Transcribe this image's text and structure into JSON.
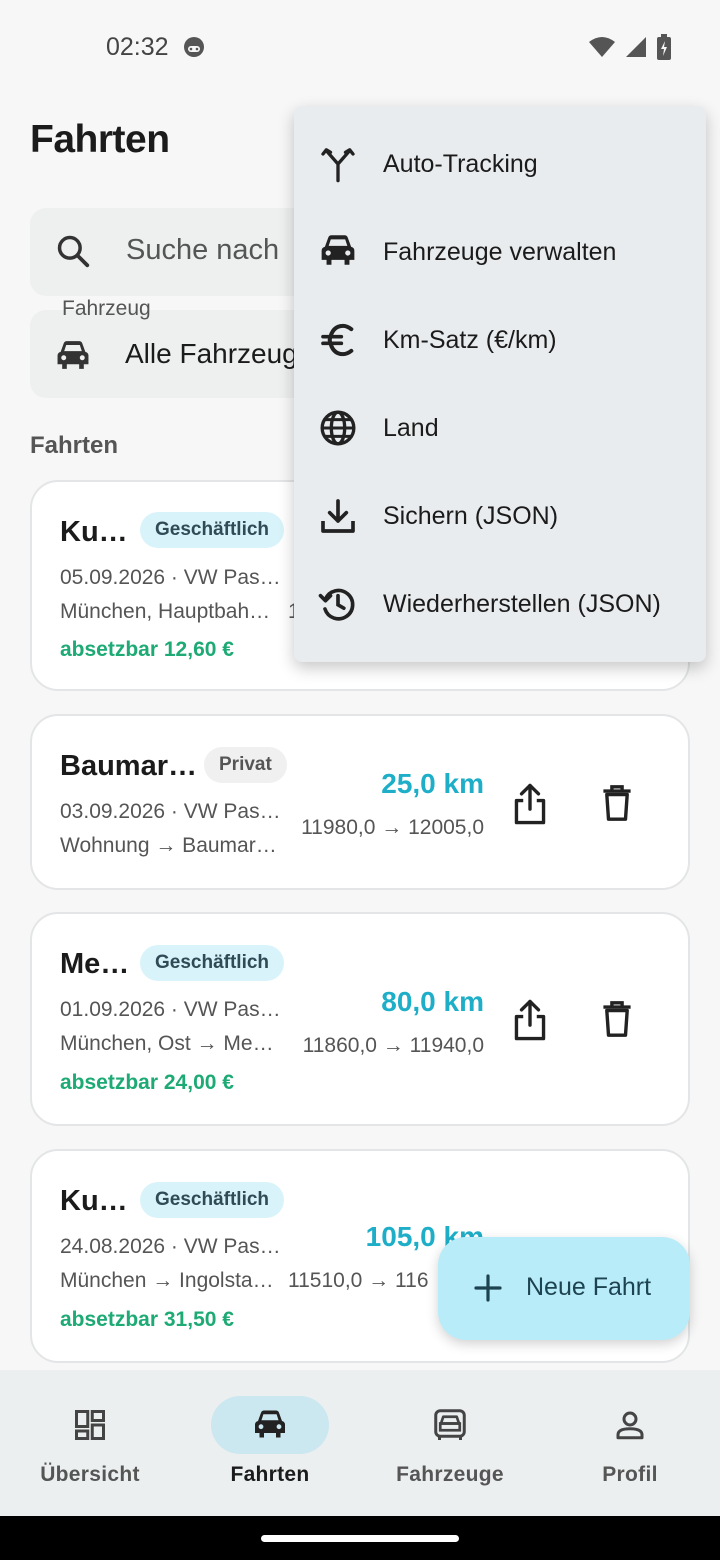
{
  "status_bar": {
    "time": "02:32"
  },
  "header": {
    "title": "Fahrten"
  },
  "search": {
    "placeholder": "Suche nach"
  },
  "vehicle_filter": {
    "label": "Fahrzeug",
    "value": "Alle Fahrzeug"
  },
  "section": {
    "title": "Fahrten"
  },
  "trips": [
    {
      "title": "Ku…",
      "category": "Geschäftlich",
      "date_vehicle": "05.09.2026 · VW Pas…",
      "route": "München, Hauptbah…",
      "odometer_partial": "1",
      "deductible": "absetzbar 12,60 €"
    },
    {
      "title": "Baumar…",
      "category": "Privat",
      "date_vehicle": "03.09.2026 · VW Pas…",
      "route": "Wohnung → Baumar…",
      "distance": "25,0 km",
      "odometer": "11980,0 → 12005,0"
    },
    {
      "title": "Me…",
      "category": "Geschäftlich",
      "date_vehicle": "01.09.2026 · VW Pas…",
      "route": "München, Ost → Me…",
      "distance": "80,0 km",
      "odometer": "11860,0 → 11940,0",
      "deductible": "absetzbar 24,00 €"
    },
    {
      "title": "Ku…",
      "category": "Geschäftlich",
      "date_vehicle": "24.08.2026 · VW Pas…",
      "route": "München → Ingolsta…",
      "distance": "105,0 km",
      "odometer": "11510,0 → 116",
      "deductible": "absetzbar 31,50 €"
    }
  ],
  "menu": {
    "items": [
      {
        "label": "Auto-Tracking",
        "icon": "fork-icon"
      },
      {
        "label": "Fahrzeuge verwalten",
        "icon": "car-icon"
      },
      {
        "label": "Km-Satz (€/km)",
        "icon": "euro-icon"
      },
      {
        "label": "Land",
        "icon": "globe-icon"
      },
      {
        "label": "Sichern (JSON)",
        "icon": "download-icon"
      },
      {
        "label": "Wiederherstellen (JSON)",
        "icon": "restore-history-icon"
      }
    ]
  },
  "fab": {
    "label": "Neue Fahrt"
  },
  "bottom_nav": {
    "items": [
      {
        "label": "Übersicht",
        "icon": "dashboard-icon"
      },
      {
        "label": "Fahrten",
        "icon": "car-icon",
        "active": true
      },
      {
        "label": "Fahrzeuge",
        "icon": "vehicle-front-icon"
      },
      {
        "label": "Profil",
        "icon": "person-icon"
      }
    ]
  },
  "colors": {
    "accent_distance": "#1eaec8",
    "deductible": "#1eaa75",
    "business_chip": "#d9f3fa",
    "fab": "#b9ecf9",
    "nav_active_pill": "#cbe7f0"
  }
}
